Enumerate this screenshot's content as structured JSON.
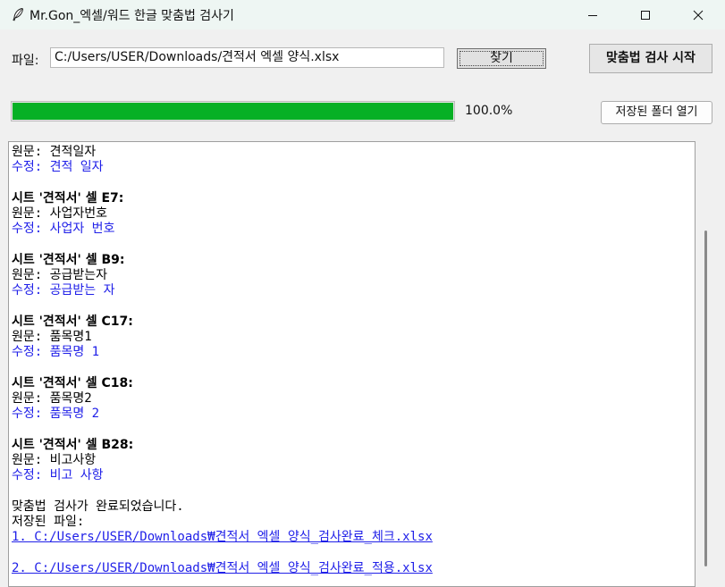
{
  "window": {
    "title": "Mr.Gon_엑셀/워드 한글 맞춤법 검사기",
    "icon": "feather-icon"
  },
  "toolbar": {
    "file_label": "파일:",
    "file_path": "C:/Users/USER/Downloads/견적서 엑셀 양식.xlsx",
    "browse_label": "찾기",
    "start_label": "맞춤법 검사 시작"
  },
  "progress": {
    "value": 1.0,
    "text": "100.0%",
    "color": "#06b025",
    "open_folder_label": "저장된 폴더 열기"
  },
  "log": [
    {
      "type": "original",
      "text": "원문: 견적일자"
    },
    {
      "type": "fixed",
      "text": "수정: 견적 일자"
    },
    {
      "type": "blank",
      "text": ""
    },
    {
      "type": "header",
      "text": "시트 '견적서' 셀 E7:"
    },
    {
      "type": "original",
      "text": "원문: 사업자번호"
    },
    {
      "type": "fixed",
      "text": "수정: 사업자 번호"
    },
    {
      "type": "blank",
      "text": ""
    },
    {
      "type": "header",
      "text": "시트 '견적서' 셀 B9:"
    },
    {
      "type": "original",
      "text": "원문: 공급받는자"
    },
    {
      "type": "fixed",
      "text": "수정: 공급받는 자"
    },
    {
      "type": "blank",
      "text": ""
    },
    {
      "type": "header",
      "text": "시트 '견적서' 셀 C17:"
    },
    {
      "type": "original",
      "text": "원문: 품목명1"
    },
    {
      "type": "fixed",
      "text": "수정: 품목명 1"
    },
    {
      "type": "blank",
      "text": ""
    },
    {
      "type": "header",
      "text": "시트 '견적서' 셀 C18:"
    },
    {
      "type": "original",
      "text": "원문: 품목명2"
    },
    {
      "type": "fixed",
      "text": "수정: 품목명 2"
    },
    {
      "type": "blank",
      "text": ""
    },
    {
      "type": "header",
      "text": "시트 '견적서' 셀 B28:"
    },
    {
      "type": "original",
      "text": "원문: 비고사항"
    },
    {
      "type": "fixed",
      "text": "수정: 비고 사항"
    },
    {
      "type": "blank",
      "text": ""
    },
    {
      "type": "mono",
      "text": "맞춤법 검사가 완료되었습니다."
    },
    {
      "type": "mono",
      "text": "저장된 파일:"
    },
    {
      "type": "link",
      "text": "1. C:/Users/USER/Downloads₩견적서 엑셀 양식_검사완료_체크.xlsx"
    },
    {
      "type": "blank",
      "text": ""
    },
    {
      "type": "link",
      "text": "2. C:/Users/USER/Downloads₩견적서 엑셀 양식_검사완료_적용.xlsx"
    }
  ]
}
